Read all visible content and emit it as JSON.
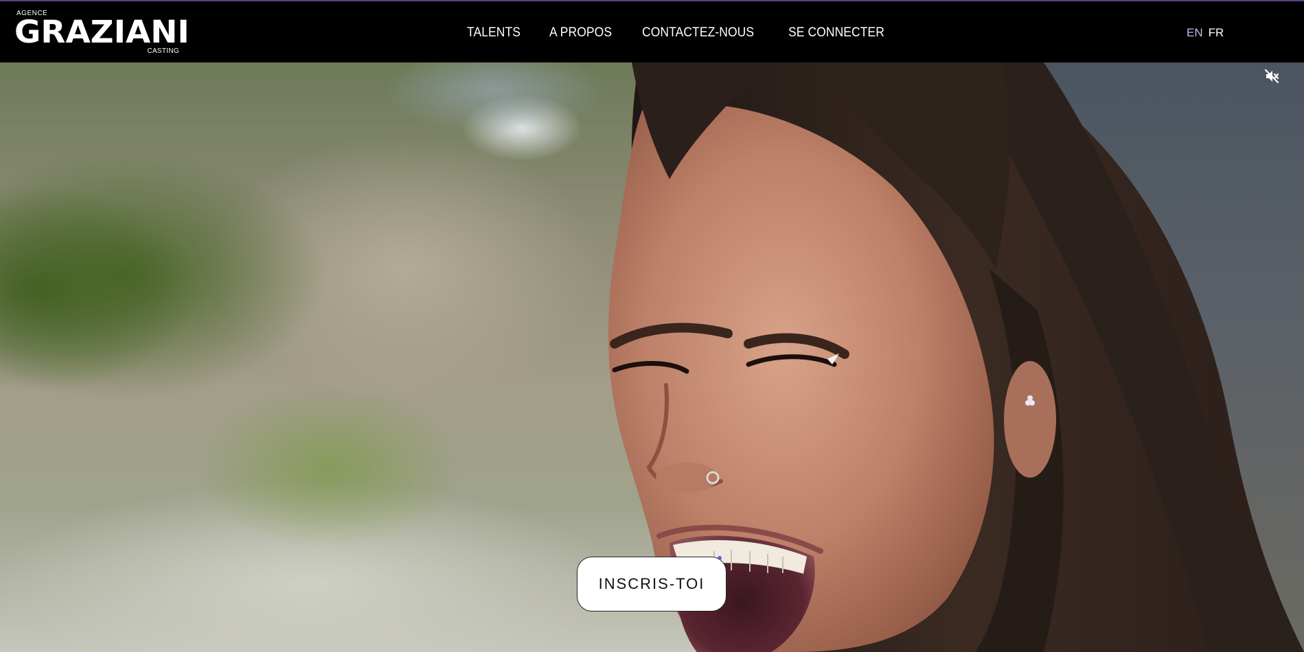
{
  "header": {
    "logo": {
      "top": "AGENCE",
      "main": "GRAZIANI",
      "bottom": "CASTING"
    },
    "nav": [
      {
        "label": "TALENTS"
      },
      {
        "label": "A PROPOS"
      },
      {
        "label": "CONTACTEZ-NOUS"
      },
      {
        "label": "SE CONNECTER"
      }
    ],
    "languages": [
      {
        "label": "EN",
        "active": true
      },
      {
        "label": "FR",
        "active": false
      }
    ]
  },
  "hero": {
    "media": "video",
    "sound_icon": "volume-muted-icon",
    "cta_label": "INSCRIS-TOI"
  },
  "colors": {
    "header_bg": "#000000",
    "header_top_border": "#5b3f86",
    "lang_active": "#c9b6f2",
    "cta_bg": "#ffffff"
  }
}
